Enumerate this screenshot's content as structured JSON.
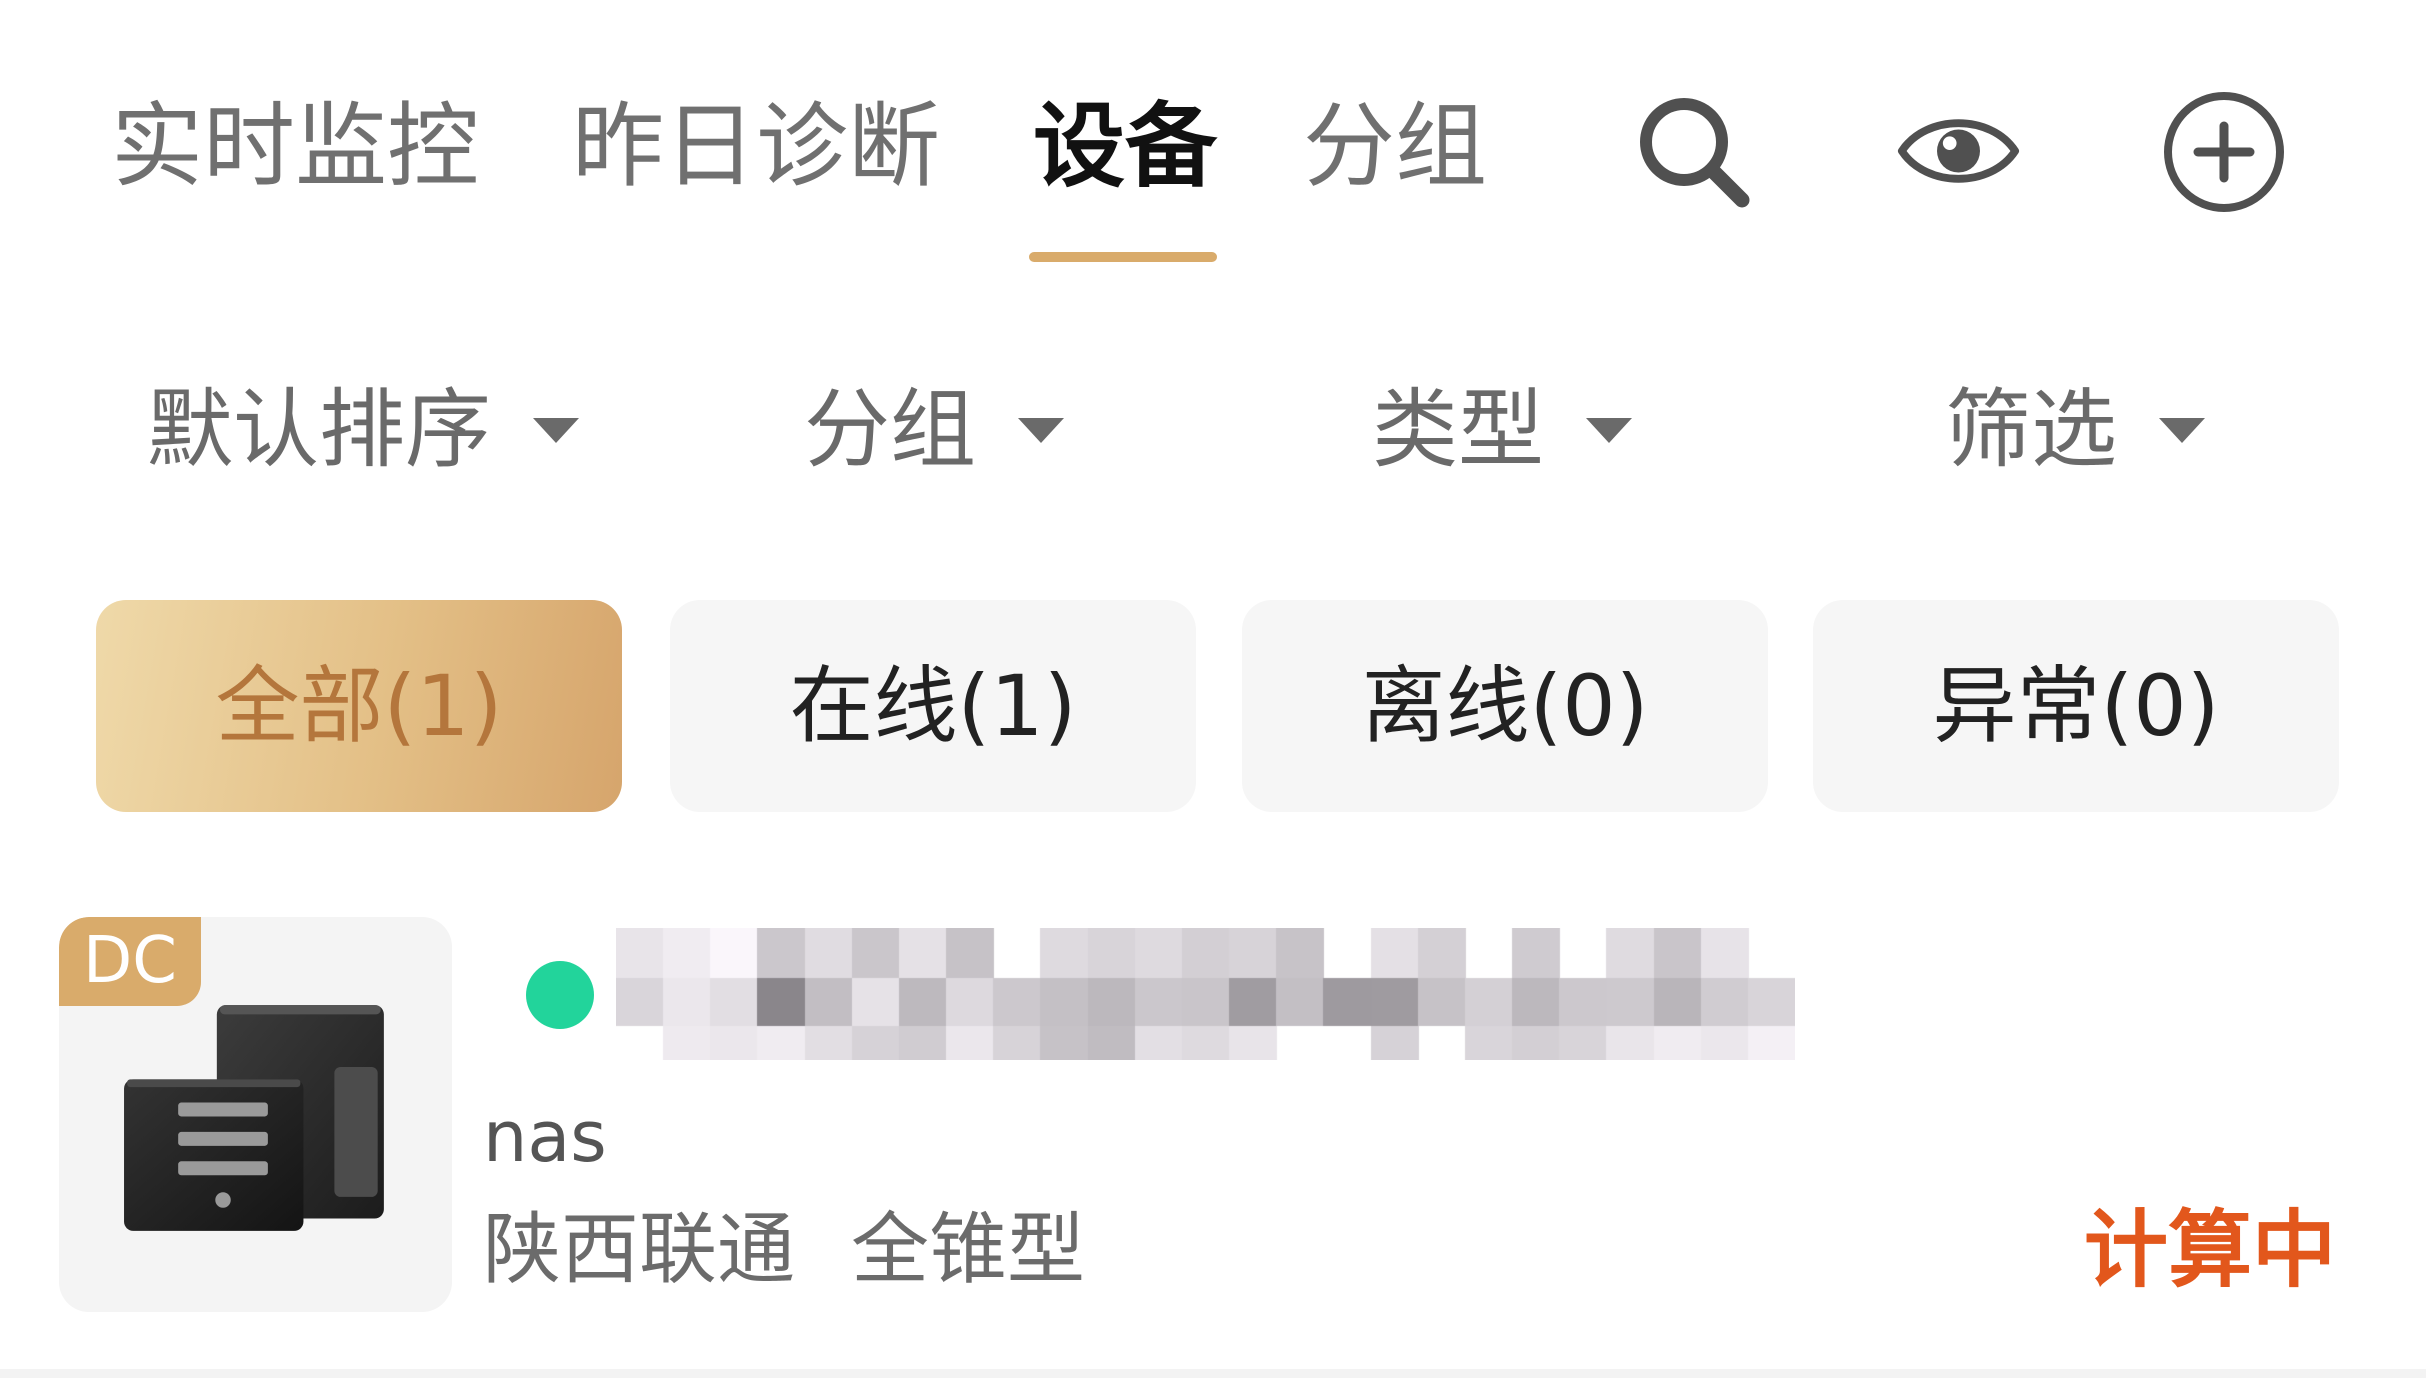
{
  "tabs": [
    {
      "label": "实时监控",
      "active": false
    },
    {
      "label": "昨日诊断",
      "active": false
    },
    {
      "label": "设备",
      "active": true
    },
    {
      "label": "分组",
      "active": false
    }
  ],
  "header_actions": [
    {
      "icon": "search-icon"
    },
    {
      "icon": "eye-icon"
    },
    {
      "icon": "add-circle-icon"
    }
  ],
  "filters": [
    {
      "label": "默认排序",
      "icon": "caret-down-icon"
    },
    {
      "label": "分组",
      "icon": "caret-down-icon"
    },
    {
      "label": "类型",
      "icon": "caret-down-icon"
    },
    {
      "label": "筛选",
      "icon": "caret-down-icon"
    }
  ],
  "status_chips": [
    {
      "label": "全部(1)",
      "active": true
    },
    {
      "label": "在线(1)",
      "active": false
    },
    {
      "label": "离线(0)",
      "active": false
    },
    {
      "label": "异常(0)",
      "active": false
    }
  ],
  "devices": [
    {
      "badge": "DC",
      "icon": "server-icon",
      "type": "nas",
      "isp": "陕西联通",
      "nat_type": "全锥型",
      "state": "计算中"
    }
  ],
  "colors": {
    "accent": "#d9ab6b",
    "active_tab_text": "#111111",
    "inactive_tab_text": "#707070",
    "chip_active_text": "#b4763c",
    "state_text": "#e2571c",
    "online_dot": "#22d49b"
  }
}
